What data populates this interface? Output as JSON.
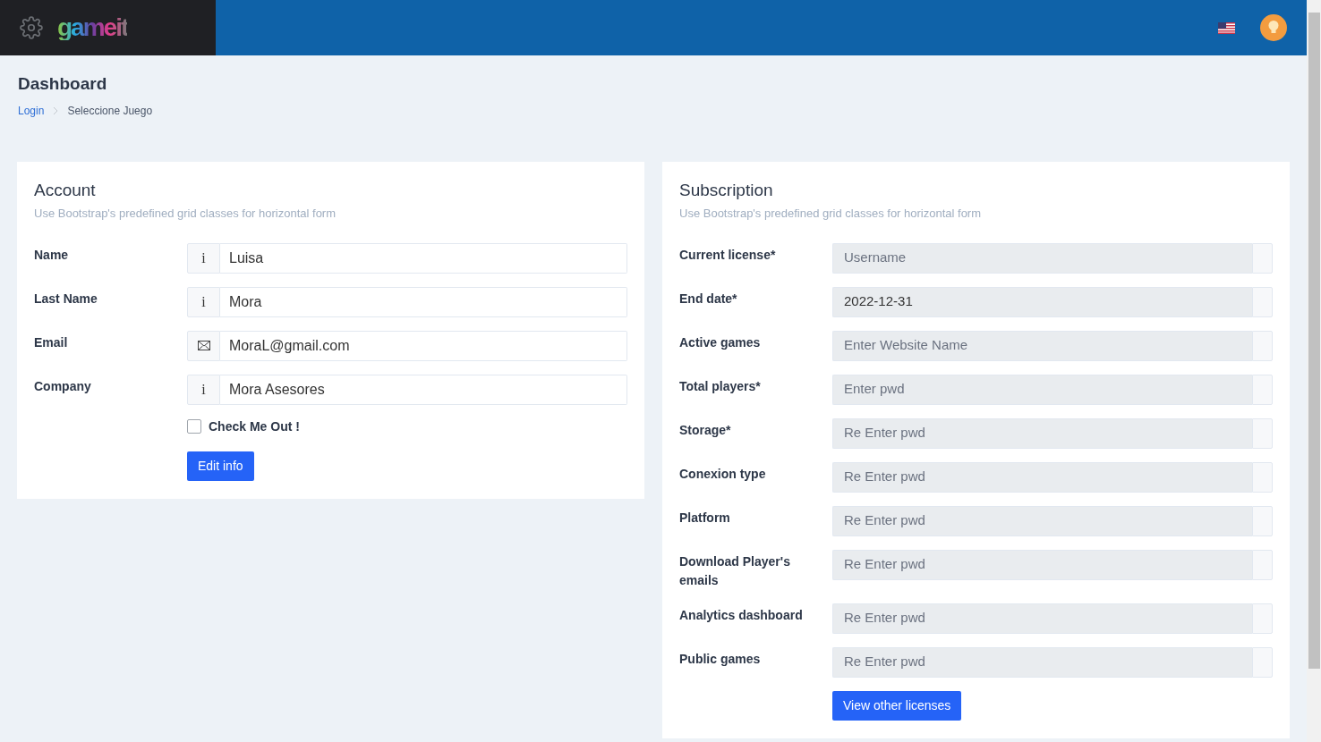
{
  "header": {
    "logo": "gameit"
  },
  "page": {
    "title": "Dashboard",
    "breadcrumb": [
      {
        "label": "Login",
        "kind": "link"
      },
      {
        "label": "Seleccione Juego",
        "kind": "current"
      }
    ]
  },
  "account": {
    "title": "Account",
    "subtitle": "Use Bootstrap's predefined grid classes for horizontal form",
    "fields": [
      {
        "label": "Name",
        "kind": "text",
        "addon": "i",
        "value": "Luisa"
      },
      {
        "label": "Last Name",
        "kind": "text",
        "addon": "i",
        "value": "Mora"
      },
      {
        "label": "Email",
        "kind": "email",
        "value": "MoraL@gmail.com"
      },
      {
        "label": "Company",
        "kind": "text",
        "addon": "i",
        "value": "Mora Asesores"
      }
    ],
    "checkbox": {
      "label": "Check Me Out !",
      "checked": false
    },
    "button": "Edit info"
  },
  "subscription": {
    "title": "Subscription",
    "subtitle": "Use Bootstrap's predefined grid classes for horizontal form",
    "fields": [
      {
        "label": "Current license*",
        "placeholder": "Username"
      },
      {
        "label": "End date*",
        "value": "2022-12-31"
      },
      {
        "label": "Active games",
        "placeholder": "Enter Website Name"
      },
      {
        "label": "Total players*",
        "placeholder": "Enter pwd"
      },
      {
        "label": "Storage*",
        "placeholder": "Re Enter pwd"
      },
      {
        "label": "Conexion type",
        "placeholder": "Re Enter pwd"
      },
      {
        "label": "Platform",
        "placeholder": "Re Enter pwd"
      },
      {
        "label": "Download Player's emails",
        "placeholder": "Re Enter pwd"
      },
      {
        "label": "Analytics dashboard",
        "placeholder": "Re Enter pwd"
      },
      {
        "label": "Public games",
        "placeholder": "Re Enter pwd"
      }
    ],
    "button": "View other licenses"
  }
}
